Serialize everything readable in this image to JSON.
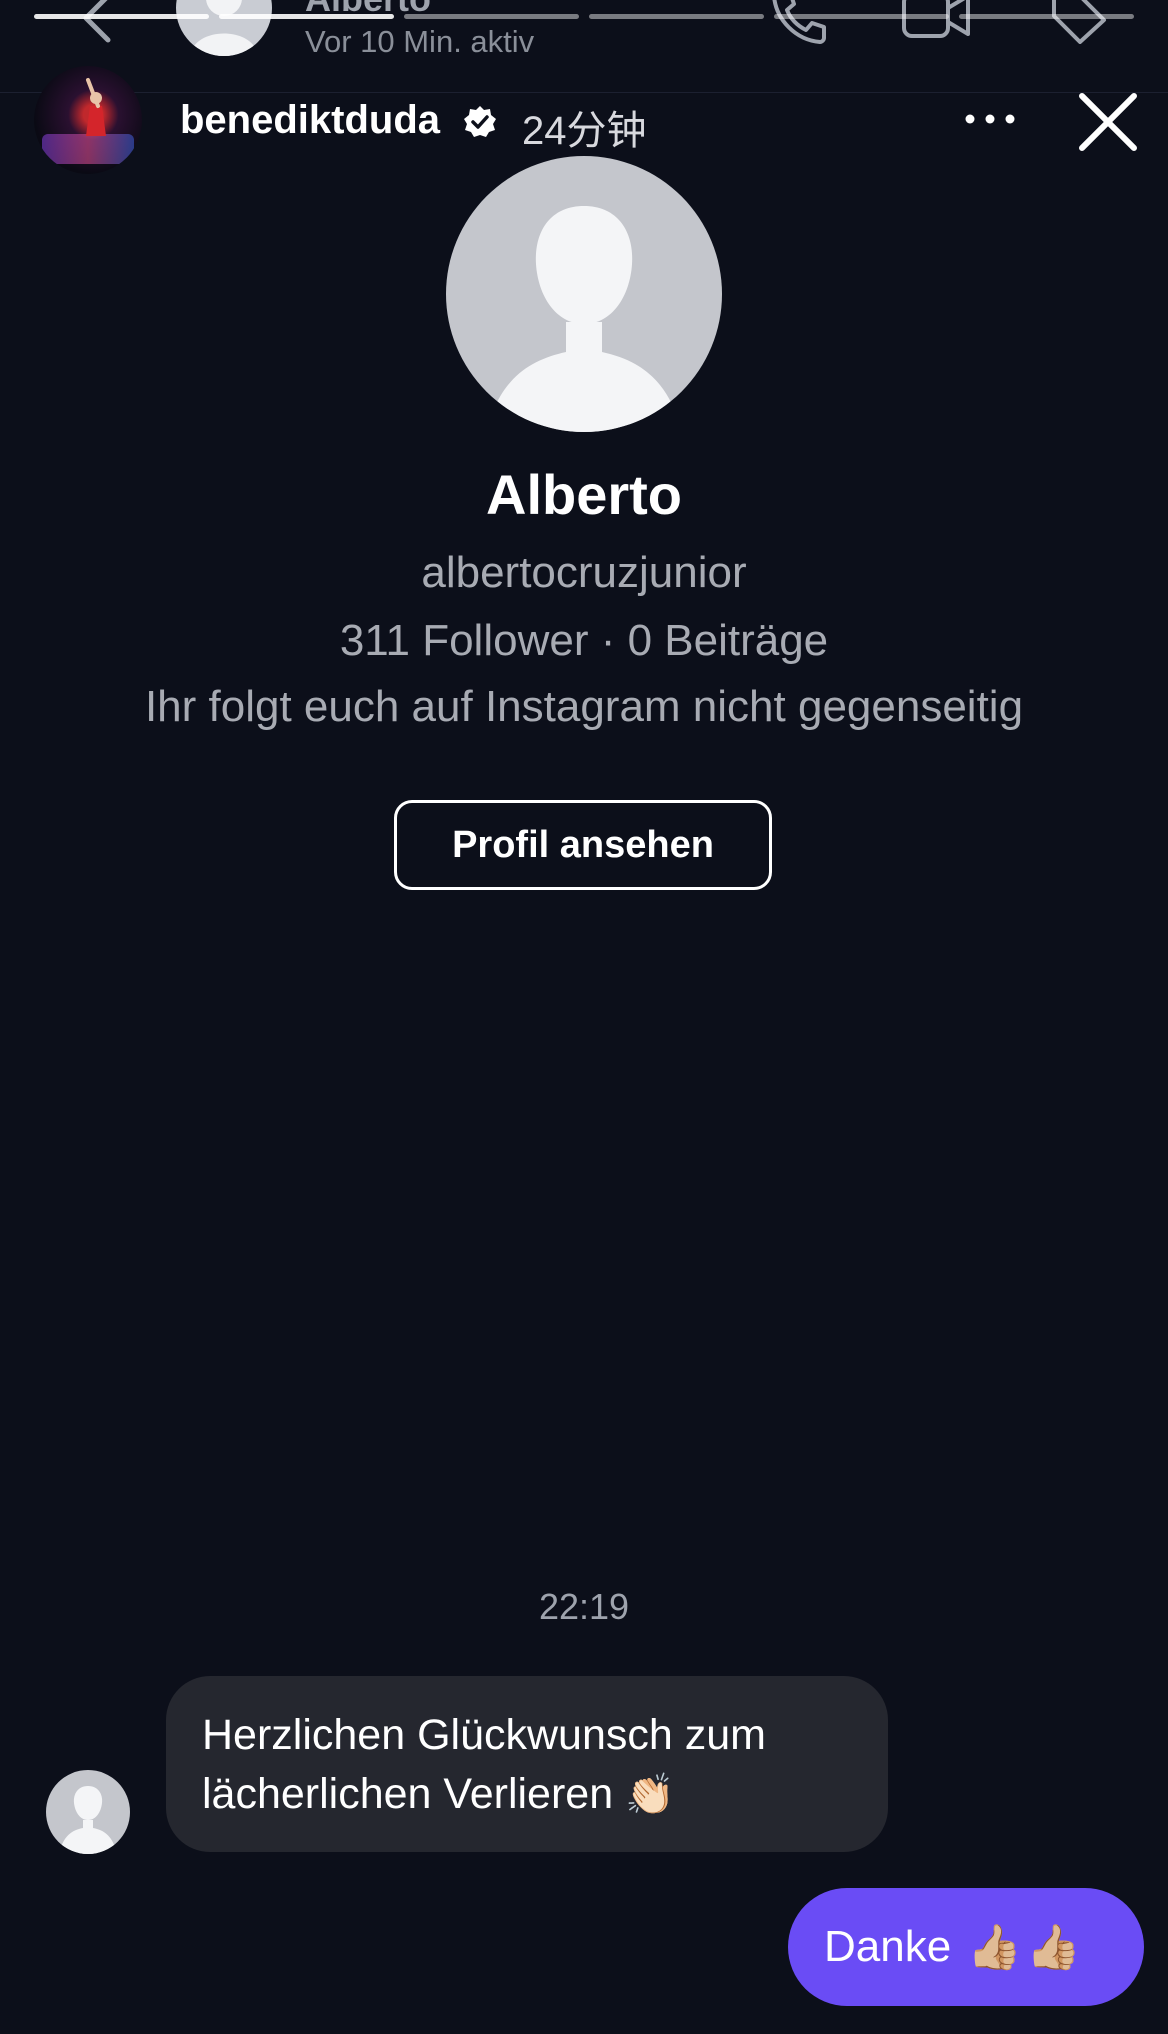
{
  "dm_header": {
    "name_partial": "Alberto",
    "active_status": "Vor 10 Min. aktiv"
  },
  "story": {
    "segments_total": 6,
    "segments_done": 2,
    "username": "benediktduda",
    "time": "24分钟"
  },
  "profile": {
    "display_name": "Alberto",
    "handle": "albertocruzjunior",
    "stats": "311 Follower · 0 Beiträge",
    "mutual_note": "Ihr folgt euch auf Instagram nicht gegenseitig",
    "view_profile_label": "Profil ansehen"
  },
  "chat": {
    "timestamp": "22:19",
    "incoming_line1": "Herzlichen Glückwunsch zum",
    "incoming_line2": "lächerlichen Verlieren",
    "incoming_emoji": "👏🏻",
    "outgoing_text": "Danke",
    "outgoing_emoji": "👍🏼👍🏼"
  },
  "colors": {
    "background": "#0c0f1a",
    "incoming_bubble": "#25272f",
    "outgoing_bubble": "#6a4cf5",
    "muted_text": "#a8abb3"
  }
}
